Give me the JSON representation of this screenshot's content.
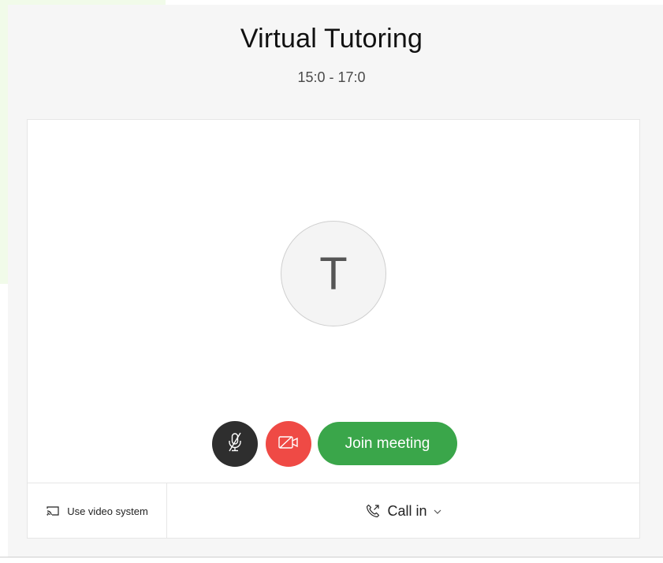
{
  "meeting": {
    "title": "Virtual Tutoring",
    "time": "15:0 - 17:0"
  },
  "avatar": {
    "initial": "T"
  },
  "controls": {
    "mute_icon": "microphone-muted-icon",
    "video_icon": "video-off-icon",
    "join_label": "Join meeting"
  },
  "footer": {
    "video_system_label": "Use video system",
    "video_system_icon": "cast-icon",
    "call_in_label": "Call in",
    "call_in_icon": "phone-outgoing-icon",
    "call_in_chevron": "chevron-down-icon"
  },
  "colors": {
    "join": "#3aa64a",
    "video_off": "#ef4a45",
    "mute": "#2e2e2e"
  }
}
